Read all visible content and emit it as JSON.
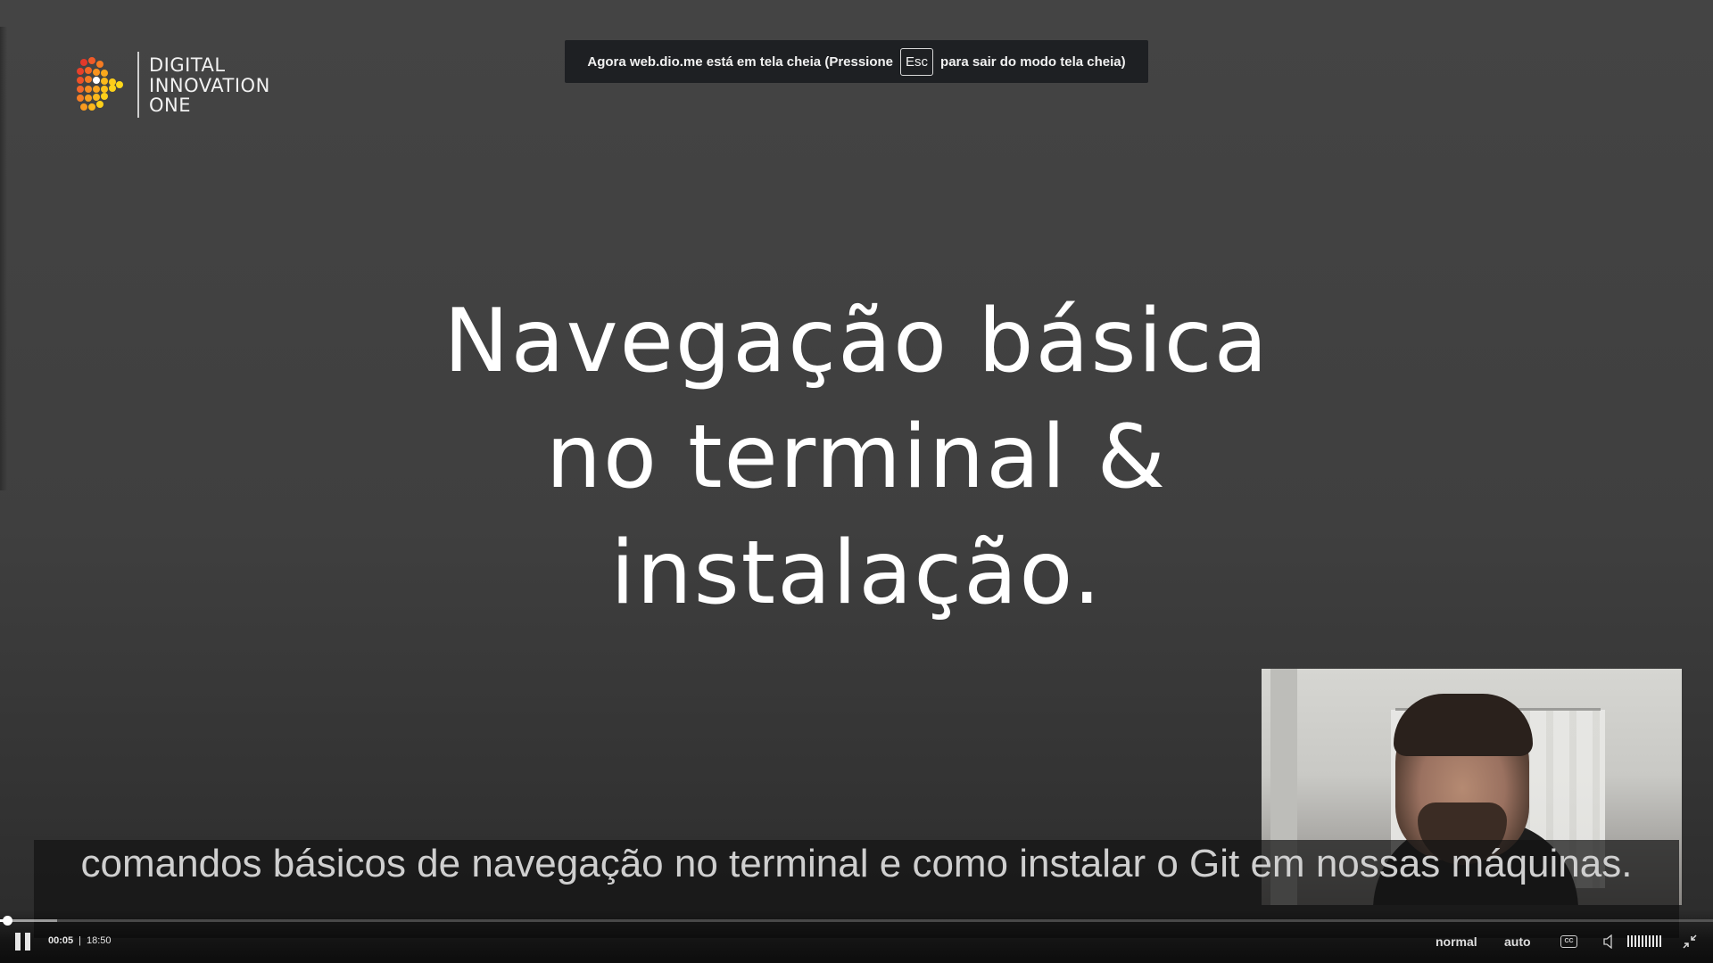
{
  "logo": {
    "lines": [
      "DIGITAL",
      "INNOVATION",
      "ONE"
    ]
  },
  "fullscreen_notice": {
    "before": "Agora web.dio.me está em tela cheia (Pressione",
    "key": "Esc",
    "after": "para sair do modo tela cheia)"
  },
  "slide": {
    "title_lines": [
      "Navegação básica",
      "no terminal &",
      "instalação."
    ]
  },
  "caption": {
    "text": "comandos básicos de navegação no terminal e como instalar o Git em nossas máquinas."
  },
  "player": {
    "current_time": "00:05",
    "duration": "18:50",
    "progress_fraction": 0.0044,
    "speed_label": "normal",
    "quality_label": "auto",
    "cc_label": "CC",
    "icons": [
      "pause-icon",
      "closed-captions-icon",
      "volume-icon",
      "volume-level-icon",
      "exit-fullscreen-icon"
    ]
  }
}
